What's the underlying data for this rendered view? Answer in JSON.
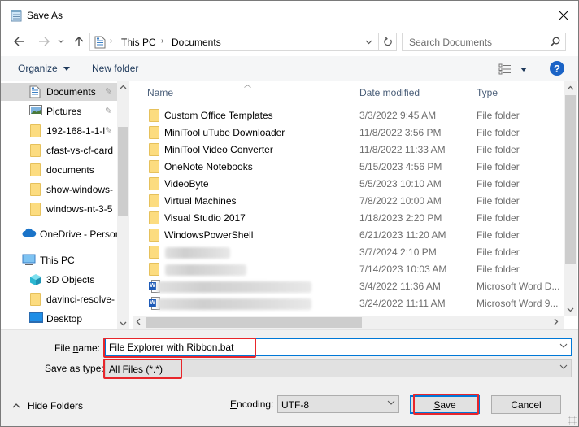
{
  "window": {
    "title": "Save As",
    "close_label": "×"
  },
  "navigation": {
    "back_icon": "←",
    "forward_icon": "→",
    "recent_icon": "⌄",
    "up_icon": "↑",
    "breadcrumb": [
      "This PC",
      "Documents"
    ],
    "breadcrumb_separator": "›",
    "search_placeholder": "Search Documents"
  },
  "toolbar": {
    "organize_label": "Organize",
    "new_folder_label": "New folder",
    "help_label": "?"
  },
  "sidebar": {
    "items": [
      {
        "label": "Documents",
        "icon": "documents-icon",
        "pinned": true,
        "selected": true
      },
      {
        "label": "Pictures",
        "icon": "pictures-icon",
        "pinned": true
      },
      {
        "label": "192-168-1-1-l",
        "icon": "folder-icon",
        "pinned": true
      },
      {
        "label": "cfast-vs-cf-card",
        "icon": "folder-icon"
      },
      {
        "label": "documents",
        "icon": "folder-icon"
      },
      {
        "label": "show-windows-",
        "icon": "folder-icon"
      },
      {
        "label": "windows-nt-3-5",
        "icon": "folder-icon"
      },
      {
        "label": "OneDrive - Person",
        "icon": "onedrive-icon"
      },
      {
        "label": "This PC",
        "icon": "this-pc-icon"
      },
      {
        "label": "3D Objects",
        "icon": "3d-objects-icon"
      },
      {
        "label": "davinci-resolve-",
        "icon": "folder-icon"
      },
      {
        "label": "Desktop",
        "icon": "desktop-icon"
      }
    ],
    "pin_glyph": "📌"
  },
  "filelist": {
    "columns": {
      "name": "Name",
      "date": "Date modified",
      "type": "Type"
    },
    "rows": [
      {
        "name": "Custom Office Templates",
        "date": "3/3/2022 9:45 AM",
        "type": "File folder",
        "icon": "folder-icon"
      },
      {
        "name": "MiniTool uTube Downloader",
        "date": "11/8/2022 3:56 PM",
        "type": "File folder",
        "icon": "folder-icon"
      },
      {
        "name": "MiniTool Video Converter",
        "date": "11/8/2022 11:33 AM",
        "type": "File folder",
        "icon": "folder-icon"
      },
      {
        "name": "OneNote Notebooks",
        "date": "5/15/2023 4:56 PM",
        "type": "File folder",
        "icon": "folder-icon"
      },
      {
        "name": "VideoByte",
        "date": "5/5/2023 10:10 AM",
        "type": "File folder",
        "icon": "folder-icon"
      },
      {
        "name": "Virtual Machines",
        "date": "7/8/2022 10:00 AM",
        "type": "File folder",
        "icon": "folder-icon"
      },
      {
        "name": "Visual Studio 2017",
        "date": "1/18/2023 2:20 PM",
        "type": "File folder",
        "icon": "folder-icon"
      },
      {
        "name": "WindowsPowerShell",
        "date": "6/21/2023 11:20 AM",
        "type": "File folder",
        "icon": "folder-icon"
      },
      {
        "name": "",
        "date": "3/7/2024 2:10 PM",
        "type": "File folder",
        "icon": "folder-icon",
        "blurred": true
      },
      {
        "name": "",
        "date": "7/14/2023 10:03 AM",
        "type": "File folder",
        "icon": "folder-icon",
        "blurred": true
      },
      {
        "name": "",
        "date": "3/4/2022 11:36 AM",
        "type": "Microsoft Word D...",
        "icon": "word-doc-icon",
        "blurred": true
      },
      {
        "name": "",
        "date": "3/24/2022 11:11 AM",
        "type": "Microsoft Word 9...",
        "icon": "word-doc-icon",
        "blurred": true
      }
    ]
  },
  "form": {
    "file_name_label_pre": "File ",
    "file_name_label_u": "n",
    "file_name_label_post": "ame:",
    "file_name_value": "File Explorer with Ribbon.bat",
    "save_type_label_pre": "Save as ",
    "save_type_label_u": "t",
    "save_type_label_post": "ype:",
    "save_type_value": "All Files  (*.*)",
    "hide_folders_label": "Hide Folders",
    "encoding_label_u": "E",
    "encoding_label_post": "ncoding:",
    "encoding_value": "UTF-8",
    "save_label_u": "S",
    "save_label_post": "ave",
    "cancel_label": "Cancel"
  },
  "annotations": {
    "highlight_color": "#e8262b"
  }
}
